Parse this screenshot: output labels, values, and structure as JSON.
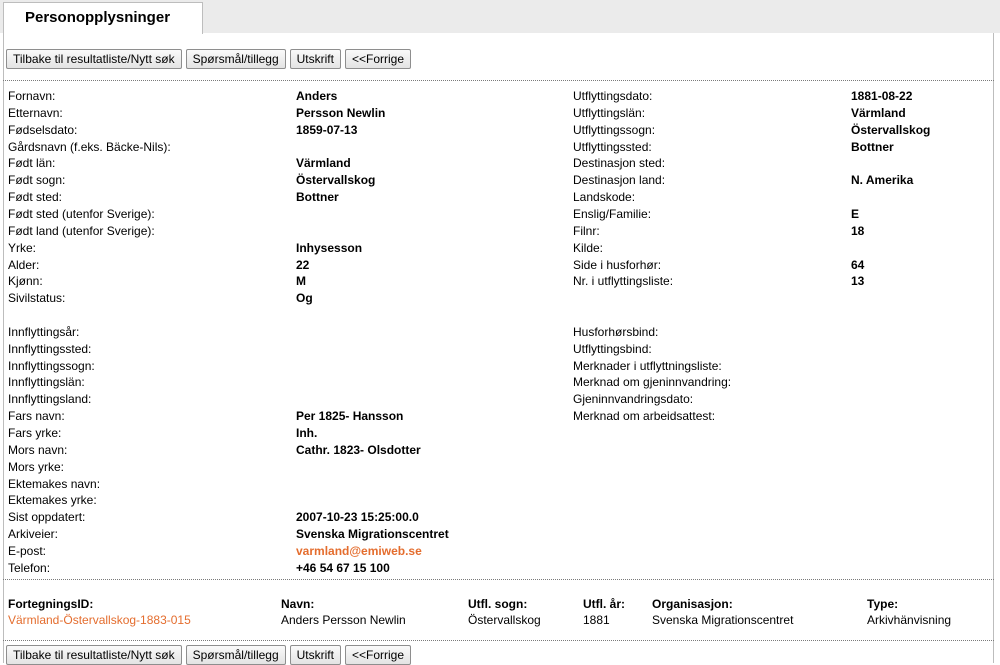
{
  "tab": {
    "title": "Personopplysninger"
  },
  "buttons": {
    "back": "Tilbake til resultatliste/Nytt søk",
    "question": "Spørsmål/tillegg",
    "print": "Utskrift",
    "previous": "<<Forrige"
  },
  "left": [
    {
      "label": "Fornavn:",
      "value": "Anders"
    },
    {
      "label": "Etternavn:",
      "value": "Persson Newlin"
    },
    {
      "label": "Fødselsdato:",
      "value": "1859-07-13"
    },
    {
      "label": "Gårdsnavn (f.eks. Bäcke-Nils):",
      "value": ""
    },
    {
      "label": "Født län:",
      "value": "Värmland"
    },
    {
      "label": "Født sogn:",
      "value": "Östervallskog"
    },
    {
      "label": "Født sted:",
      "value": "Bottner"
    },
    {
      "label": "Født sted (utenfor Sverige):",
      "value": ""
    },
    {
      "label": "Født land (utenfor Sverige):",
      "value": ""
    },
    {
      "label": "Yrke:",
      "value": "Inhysesson"
    },
    {
      "label": "Alder:",
      "value": "22"
    },
    {
      "label": "Kjønn:",
      "value": "M"
    },
    {
      "label": "Sivilstatus:",
      "value": "Og"
    },
    {
      "label": "",
      "value": ""
    },
    {
      "label": "Innflyttingsår:",
      "value": ""
    },
    {
      "label": "Innflyttingssted:",
      "value": ""
    },
    {
      "label": "Innflyttingssogn:",
      "value": ""
    },
    {
      "label": "Innflyttingslän:",
      "value": ""
    },
    {
      "label": "Innflyttingsland:",
      "value": ""
    },
    {
      "label": "Fars navn:",
      "value": "Per 1825- Hansson"
    },
    {
      "label": "Fars yrke:",
      "value": "Inh."
    },
    {
      "label": "Mors navn:",
      "value": "Cathr. 1823- Olsdotter"
    },
    {
      "label": "Mors yrke:",
      "value": ""
    },
    {
      "label": "Ektemakes navn:",
      "value": ""
    },
    {
      "label": "Ektemakes yrke:",
      "value": ""
    },
    {
      "label": "Sist oppdatert:",
      "value": "2007-10-23 15:25:00.0"
    },
    {
      "label": "Arkiveier:",
      "value": "Svenska Migrationscentret"
    },
    {
      "label": "E-post:",
      "value": "varmland@emiweb.se"
    },
    {
      "label": "Telefon:",
      "value": "+46 54 67 15 100"
    }
  ],
  "right": [
    {
      "label": "Utflyttingsdato:",
      "value": "1881-08-22"
    },
    {
      "label": "Utflyttingslän:",
      "value": "Värmland"
    },
    {
      "label": "Utflyttingssogn:",
      "value": "Östervallskog"
    },
    {
      "label": "Utflyttingssted:",
      "value": "Bottner"
    },
    {
      "label": "Destinasjon sted:",
      "value": ""
    },
    {
      "label": "Destinasjon land:",
      "value": "N. Amerika"
    },
    {
      "label": "Landskode:",
      "value": ""
    },
    {
      "label": "Enslig/Familie:",
      "value": "E"
    },
    {
      "label": "Filnr:",
      "value": "18"
    },
    {
      "label": "Kilde:",
      "value": ""
    },
    {
      "label": "Side i husforhør:",
      "value": "64"
    },
    {
      "label": "Nr. i utflyttingsliste:",
      "value": "13"
    },
    {
      "label": "",
      "value": ""
    },
    {
      "label": "",
      "value": ""
    },
    {
      "label": "Husforhørsbind:",
      "value": ""
    },
    {
      "label": "Utflyttingsbind:",
      "value": ""
    },
    {
      "label": "Merknader i utflyttningsliste:",
      "value": ""
    },
    {
      "label": "Merknad om gjeninnvandring:",
      "value": ""
    },
    {
      "label": "Gjeninnvandringsdato:",
      "value": ""
    },
    {
      "label": "Merknad om arbeidsattest:",
      "value": ""
    }
  ],
  "footer": {
    "headers": {
      "id": "FortegningsID:",
      "name": "Navn:",
      "parish": "Utfl. sogn:",
      "year": "Utfl. år:",
      "org": "Organisasjon:",
      "type": "Type:"
    },
    "values": {
      "id": "Värmland-Östervallskog-1883-015",
      "name": "Anders Persson Newlin",
      "parish": "Östervallskog",
      "year": "1881",
      "org": "Svenska Migrationscentret",
      "type": "Arkivhänvisning"
    }
  },
  "colors": {
    "link": "#e46d2e"
  }
}
